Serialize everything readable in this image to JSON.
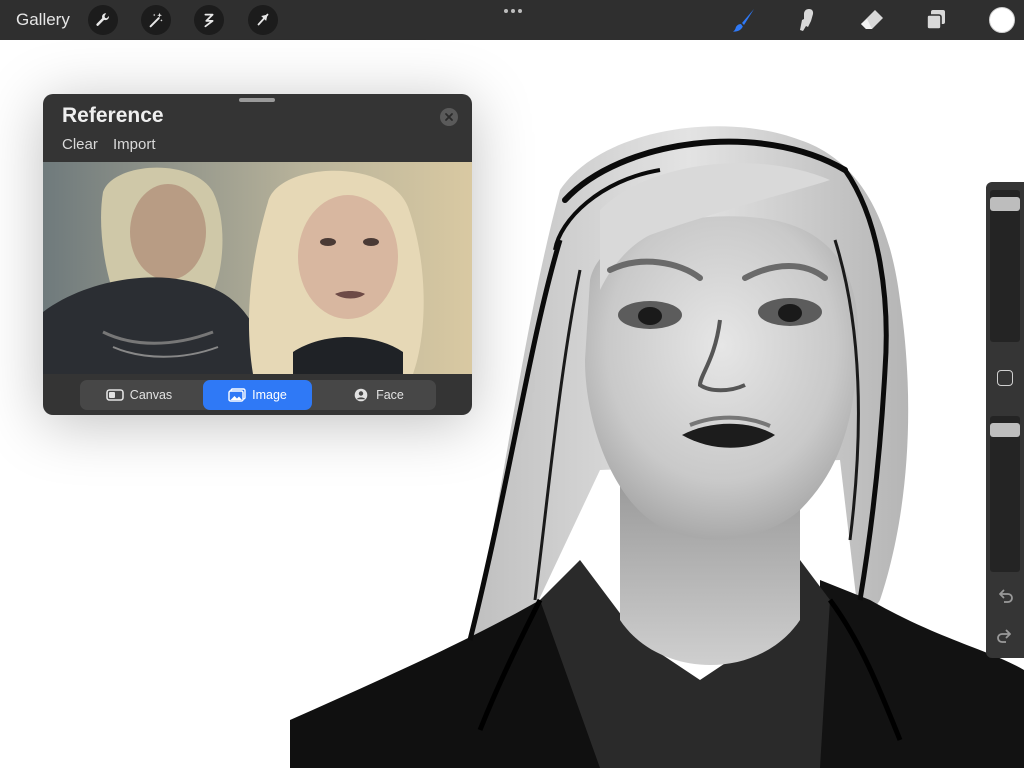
{
  "toolbar": {
    "gallery_label": "Gallery",
    "left_tools": [
      "wrench-icon",
      "magic-wand-icon",
      "selection-icon",
      "transform-arrow-icon"
    ],
    "right_tools": [
      "brush-icon",
      "smudge-icon",
      "eraser-icon",
      "layers-icon"
    ],
    "accent_color": "#2f79f6",
    "current_color": "#ffffff"
  },
  "reference": {
    "title": "Reference",
    "clear_label": "Clear",
    "import_label": "Import",
    "tabs": [
      {
        "label": "Canvas",
        "icon": "canvas-icon"
      },
      {
        "label": "Image",
        "icon": "image-icon",
        "active": true
      },
      {
        "label": "Face",
        "icon": "face-icon"
      }
    ]
  },
  "sidebar": {
    "brush_size_level": 0.95,
    "opacity_level": 0.95
  }
}
